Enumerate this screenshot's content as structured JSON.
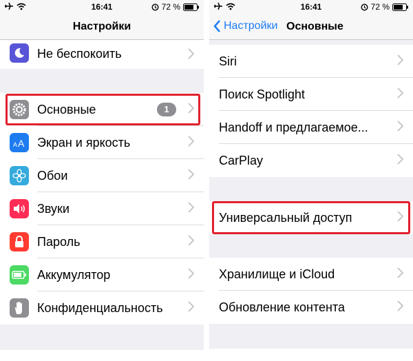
{
  "status": {
    "time": "16:41",
    "battery": "72 %"
  },
  "left": {
    "nav_title": "Настройки",
    "items": [
      {
        "label": "Не беспокоить",
        "icon": "moon-icon",
        "color": "#5856d6"
      },
      {
        "label": "Основные",
        "icon": "gear-icon",
        "color": "#8e8e93",
        "badge": "1"
      },
      {
        "label": "Экран и яркость",
        "icon": "text-size-icon",
        "color": "#1e7cf0"
      },
      {
        "label": "Обои",
        "icon": "flower-icon",
        "color": "#35aadc"
      },
      {
        "label": "Звуки",
        "icon": "speaker-icon",
        "color": "#ff2d55"
      },
      {
        "label": "Пароль",
        "icon": "lock-icon",
        "color": "#ff3b30"
      },
      {
        "label": "Аккумулятор",
        "icon": "battery-icon",
        "color": "#4cd964"
      },
      {
        "label": "Конфиденциальность",
        "icon": "hand-icon",
        "color": "#8e8e93"
      }
    ]
  },
  "right": {
    "back_label": "Настройки",
    "nav_title": "Основные",
    "items": [
      {
        "label": "Siri"
      },
      {
        "label": "Поиск Spotlight"
      },
      {
        "label": "Handoff и предлагаемое..."
      },
      {
        "label": "CarPlay"
      },
      {
        "label": "Универсальный доступ"
      },
      {
        "label": "Хранилище и iCloud"
      },
      {
        "label": "Обновление контента"
      }
    ]
  },
  "colors": {
    "accent": "#1e7cf0",
    "highlight": "#e2202c"
  }
}
